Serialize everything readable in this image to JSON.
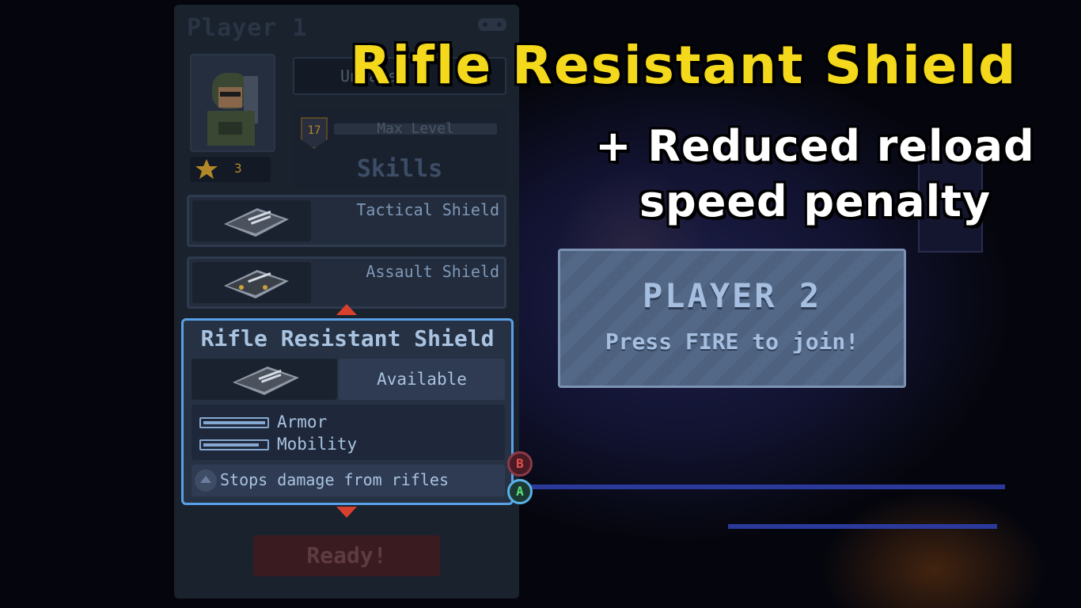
{
  "caption": {
    "title": "Rifle Resistant Shield",
    "subtitle_line1": "+ Reduced reload",
    "subtitle_line2": "speed penalty"
  },
  "player1": {
    "header": "Player 1",
    "name_field": "Unnamed",
    "rank": "3",
    "level": "17",
    "level_label": "Max Level",
    "skills_label": "Skills",
    "items": [
      {
        "label": "Tactical Shield"
      },
      {
        "label": "Assault Shield"
      }
    ],
    "selected_item": {
      "title": "Rifle Resistant Shield",
      "status": "Available",
      "stats": [
        {
          "label": "Armor",
          "level": 1.0
        },
        {
          "label": "Mobility",
          "level": 0.9
        }
      ],
      "description": "Stops damage from rifles"
    },
    "controls": {
      "back": "B",
      "confirm": "A"
    },
    "ready_button": "Ready!"
  },
  "player2": {
    "title": "PLAYER 2",
    "prompt": "Press FIRE to join!"
  },
  "colors": {
    "caption_title": "#f3d81b",
    "caption_subtitle": "#ffffff",
    "panel_bg": "#1b2330",
    "selection_border": "#5aa0e6",
    "arrow": "#d8402e",
    "ready_bg": "#3a1b20"
  },
  "icons": [
    "gamepad-icon",
    "star-icon",
    "shield-icon",
    "chevron-up-icon",
    "chevron-down-icon"
  ]
}
